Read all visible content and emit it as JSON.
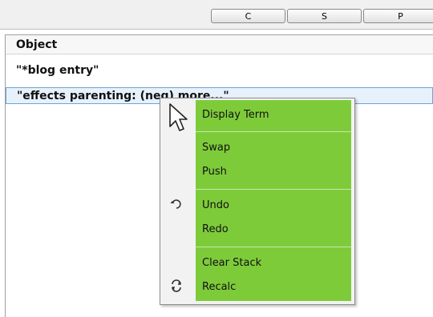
{
  "toolbar": {
    "buttons": [
      {
        "label": "C"
      },
      {
        "label": "S"
      },
      {
        "label": "P"
      }
    ]
  },
  "list": {
    "column_header": "Object",
    "rows": [
      {
        "text": "\"*blog entry\""
      },
      {
        "text": "\"effects parenting: (neg) more...\""
      }
    ]
  },
  "context_menu": {
    "items": [
      {
        "label": "Display Term"
      },
      {
        "label": "Swap"
      },
      {
        "label": "Push"
      },
      {
        "label": "Undo",
        "icon": "undo-icon"
      },
      {
        "label": "Redo"
      },
      {
        "label": "Clear Stack"
      },
      {
        "label": "Recalc",
        "icon": "recalc-icon"
      }
    ]
  },
  "colors": {
    "menu_highlight": "#7ecb3a",
    "selection_border": "#6fa3d6",
    "selection_fill": "#e7f1fb"
  }
}
